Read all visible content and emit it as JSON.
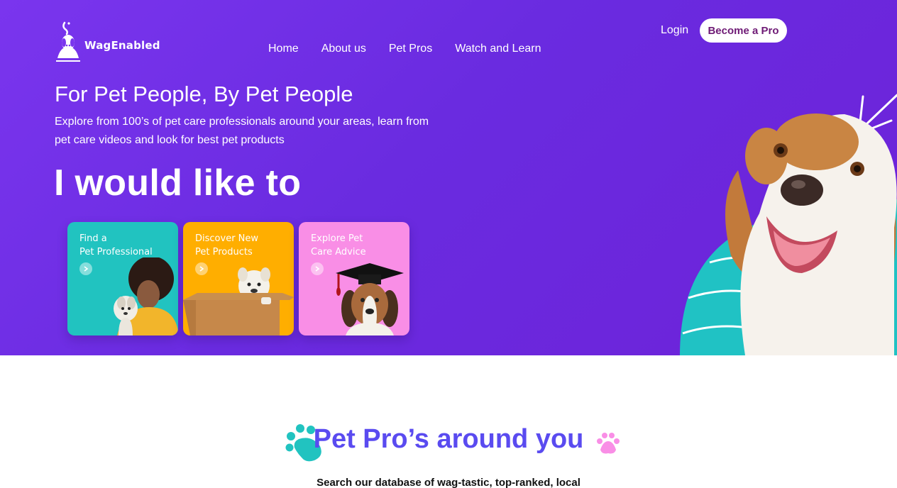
{
  "header": {
    "logo_text": "WagEnabled",
    "nav": [
      "Home",
      "About us",
      "Pet Pros",
      "Watch and Learn"
    ],
    "login": "Login",
    "cta": "Become a Pro"
  },
  "hero": {
    "title": "For Pet People, By Pet People",
    "subtitle": "Explore from 100’s of pet care professionals around your areas, learn from pet care videos and look for best pet products",
    "big_heading": "I would like to",
    "cards": [
      {
        "line1": "Find a",
        "line2": "Pet Professional",
        "color": "#21c3c0"
      },
      {
        "line1": "Discover New",
        "line2": "Pet Products",
        "color": "#ffae00"
      },
      {
        "line1": "Explore Pet",
        "line2": "Care Advice",
        "color": "#f98ee6"
      }
    ]
  },
  "section": {
    "title": "Pet Pro’s around you",
    "subtitle": "Search our database of wag-tastic, top-ranked, local"
  },
  "colors": {
    "hero_bg": "#7a35ee",
    "teal": "#21c3c0",
    "orange": "#ffae00",
    "pink": "#f98ee6",
    "title_blue": "#5a4bf0",
    "cta_text": "#6e1a75"
  },
  "icons": [
    "dog-logo-icon",
    "chevron-right-icon",
    "paw-teal-icon",
    "paw-pink-icon"
  ]
}
